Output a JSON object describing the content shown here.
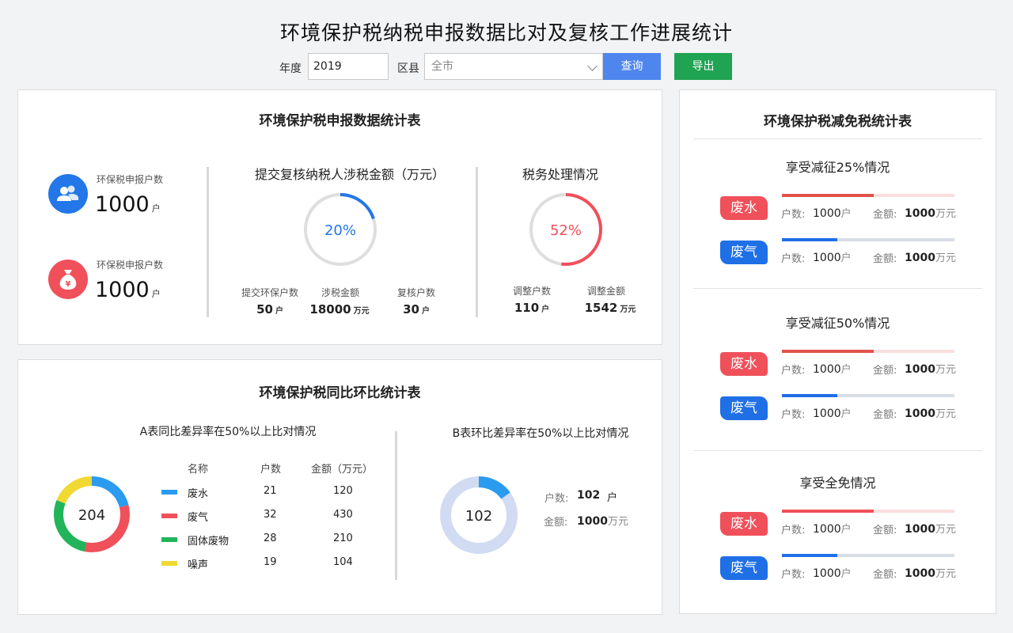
{
  "page_title": "环境保护税纳税申报数据比对及复核工作进展统计",
  "filters": {
    "year_label": "年度",
    "year_value": "2019",
    "district_label": "区县",
    "district_value": "全市",
    "query_label": "查询",
    "export_label": "导出"
  },
  "declaration": {
    "title": "环境保护税申报数据统计表",
    "summary": [
      {
        "label": "环保税申报户数",
        "value": "1000",
        "unit": "户",
        "icon": "users-icon",
        "color": "#2377e8"
      },
      {
        "label": "环保税申报户数",
        "value": "1000",
        "unit": "户",
        "icon": "money-bag-icon",
        "color": "#f0505a"
      }
    ],
    "review": {
      "title": "提交复核纳税人涉税金额（万元）",
      "percent": 20,
      "percent_text": "20%",
      "color": "#2377e8",
      "stats": [
        {
          "label": "提交环保户数",
          "value": "50",
          "unit": "户"
        },
        {
          "label": "涉税金额",
          "value": "18000",
          "unit": "万元"
        },
        {
          "label": "复核户数",
          "value": "30",
          "unit": "户"
        }
      ]
    },
    "handling": {
      "title": "税务处理情况",
      "percent": 52,
      "percent_text": "52%",
      "color": "#f0505a",
      "stats": [
        {
          "label": "调整户数",
          "value": "110",
          "unit": "户"
        },
        {
          "label": "调整金额",
          "value": "1542",
          "unit": "万元"
        }
      ]
    }
  },
  "comparison": {
    "title": "环境保护税同比环比统计表",
    "table_a": {
      "title": "A表同比差异率在50%以上比对情况",
      "center_value": "204",
      "headers": [
        "名称",
        "户数",
        "金额（万元）"
      ],
      "rows": [
        {
          "name": "废水",
          "count": "21",
          "amount": "120",
          "color": "#2b9bf0"
        },
        {
          "name": "废气",
          "count": "32",
          "amount": "430",
          "color": "#f0505a"
        },
        {
          "name": "固体废物",
          "count": "28",
          "amount": "210",
          "color": "#22b45a"
        },
        {
          "name": "噪声",
          "count": "19",
          "amount": "104",
          "color": "#f0d932"
        }
      ]
    },
    "table_b": {
      "title": "B表环比差异率在50%以上比对情况",
      "center_value": "102",
      "percent": 15,
      "color": "#2b9bf0",
      "track_color": "#d1dbf2",
      "count_label": "户数:",
      "count_value": "102",
      "count_unit": "户",
      "amount_label": "金额:",
      "amount_value": "1000",
      "amount_unit": "万元"
    }
  },
  "relief": {
    "title": "环境保护税减免税统计表",
    "groups": [
      {
        "title": "享受减征25%情况",
        "items": [
          {
            "tag": "废水",
            "tag_color": "red",
            "fill": 0.53,
            "fill_color": "#e0524a",
            "track_color": "#f9dede",
            "count_label": "户数:",
            "count": "1000",
            "count_unit": "户",
            "amount_label": "金额:",
            "amount": "1000",
            "amount_unit": "万元"
          },
          {
            "tag": "废气",
            "tag_color": "blue",
            "fill": 0.32,
            "fill_color": "#1f6fe6",
            "track_color": "#d9dde6",
            "count_label": "户数:",
            "count": "1000",
            "count_unit": "户",
            "amount_label": "金额:",
            "amount": "1000",
            "amount_unit": "万元"
          }
        ]
      },
      {
        "title": "享受减征50%情况",
        "items": [
          {
            "tag": "废水",
            "tag_color": "red",
            "fill": 0.53,
            "fill_color": "#e0524a",
            "track_color": "#f9dede",
            "count_label": "户数:",
            "count": "1000",
            "count_unit": "户",
            "amount_label": "金额:",
            "amount": "1000",
            "amount_unit": "万元"
          },
          {
            "tag": "废气",
            "tag_color": "blue",
            "fill": 0.32,
            "fill_color": "#1f6fe6",
            "track_color": "#d9dde6",
            "count_label": "户数:",
            "count": "1000",
            "count_unit": "户",
            "amount_label": "金额:",
            "amount": "1000",
            "amount_unit": "万元"
          }
        ]
      },
      {
        "title": "享受全免情况",
        "items": [
          {
            "tag": "废水",
            "tag_color": "red",
            "fill": 0.53,
            "fill_color": "#f0505a",
            "track_color": "#f9dede",
            "count_label": "户数:",
            "count": "1000",
            "count_unit": "户",
            "amount_label": "金额:",
            "amount": "1000",
            "amount_unit": "万元"
          },
          {
            "tag": "废气",
            "tag_color": "blue",
            "fill": 0.32,
            "fill_color": "#1f6fe6",
            "track_color": "#d9dde6",
            "count_label": "户数:",
            "count": "1000",
            "count_unit": "户",
            "amount_label": "金额:",
            "amount": "1000",
            "amount_unit": "万元"
          }
        ]
      }
    ]
  }
}
